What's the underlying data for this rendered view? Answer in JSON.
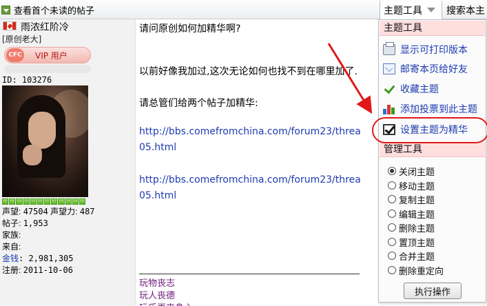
{
  "topbar": {
    "first_unread": "查看首个未读的帖子",
    "topic_tools_tab": "主题工具",
    "search_tab": "搜索本主"
  },
  "user": {
    "name": "雨浓红阶冷",
    "rank": "[原创老大]",
    "badge_logo": "CFC",
    "badge_label": "VIP 用户",
    "id_line": "ID: 103276",
    "reputation_segments": 12,
    "stats": {
      "rep_label": "声望:",
      "rep_value": "47504",
      "rep_power_label": "声望力:",
      "rep_power_value": "487",
      "posts_label": "帖子:",
      "posts_value": "1,953",
      "family_label": "家族:",
      "from_label": "来自:",
      "money_label": "金钱",
      "money_value": ": 2,981,305",
      "joined_label": "注册:",
      "joined_value": "2011-10-06"
    }
  },
  "post": {
    "line1": "请问原创如何加精华啊?",
    "line2": "以前好像我加过,这次无论如何也找不到在哪里加了.",
    "line3": "请总管们给两个帖子加精华:",
    "link1_a": "http://bbs.comefromchina.com/forum23/threa",
    "link1_b": "05.html",
    "link2_a": "http://bbs.comefromchina.com/forum23/threa",
    "link2_b": "05.html",
    "sig1": "玩物丧志",
    "sig2": "玩人丧德",
    "sig3": "玩乐再丧身心"
  },
  "menu": {
    "topic_tools_header": "主题工具",
    "items": [
      {
        "label": "显示可打印版本",
        "icon": "printer-icon"
      },
      {
        "label": "邮寄本页给好友",
        "icon": "mail-icon"
      },
      {
        "label": "收藏主题",
        "icon": "checkmark-icon"
      },
      {
        "label": "添加投票到此主题",
        "icon": "poll-chart-icon"
      },
      {
        "label": "设置主题为精华",
        "icon": "checkbox-icon"
      }
    ],
    "admin_tools_header": "管理工具",
    "radios": [
      {
        "label": "关闭主题",
        "checked": true
      },
      {
        "label": "移动主题",
        "checked": false
      },
      {
        "label": "复制主题",
        "checked": false
      },
      {
        "label": "编辑主题",
        "checked": false
      },
      {
        "label": "删除主题",
        "checked": false
      },
      {
        "label": "置顶主题",
        "checked": false
      },
      {
        "label": "合并主题",
        "checked": false
      },
      {
        "label": "删除重定向",
        "checked": false
      }
    ],
    "execute_button": "执行操作"
  },
  "colors": {
    "link": "#1d3bb0",
    "annotation": "#e01818",
    "menu_header_bg": "#ffdede",
    "signature": "#6b1a7a"
  }
}
